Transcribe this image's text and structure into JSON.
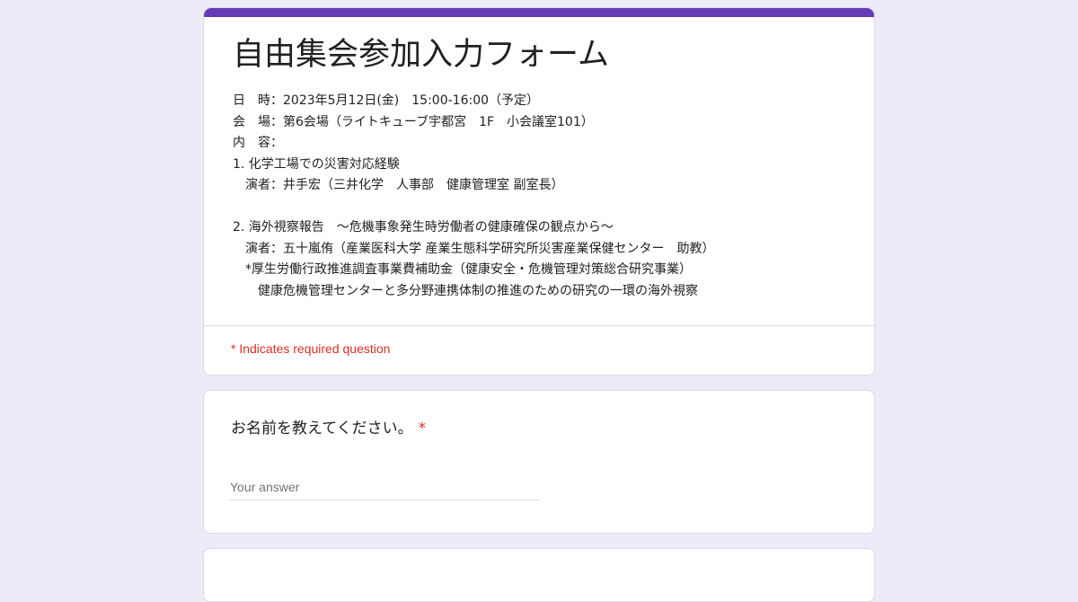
{
  "colors": {
    "page_background": "#efeaf7",
    "accent": "#673ab7",
    "required": "#d93025"
  },
  "form": {
    "title": "自由集会参加入力フォーム",
    "description_lines": [
      "日　時：2023年5月12日(金)　15:00-16:00（予定）",
      "会　場：第6会場（ライトキューブ宇都宮　1F　小会議室101）",
      "内　容：",
      "1. 化学工場での災害対応経験",
      "　演者：井手宏（三井化学　人事部　健康管理室 副室長）",
      "",
      "2. 海外視察報告　～危機事象発生時労働者の健康確保の観点から～",
      "　演者：五十嵐侑（産業医科大学 産業生態科学研究所災害産業保健センター　助教）",
      "　*厚生労働行政推進調査事業費補助金（健康安全・危機管理対策総合研究事業）",
      "　　健康危機管理センターと多分野連携体制の推進のための研究の一環の海外視察"
    ],
    "required_note": "* Indicates required question"
  },
  "questions": [
    {
      "label": "お名前を教えてください。",
      "required_mark": "*",
      "placeholder": "Your answer",
      "value": ""
    }
  ]
}
